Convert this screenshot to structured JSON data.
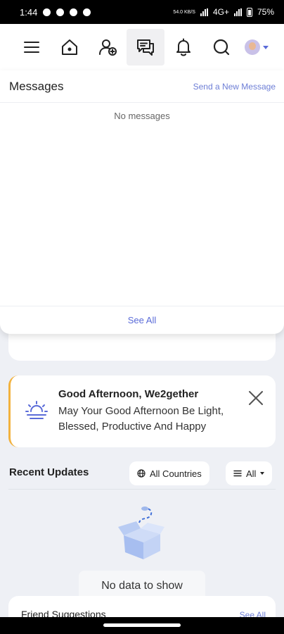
{
  "status_bar": {
    "time": "1:44",
    "network_speed": "54.0 KB/S",
    "network_type": "4G+",
    "battery": "75%"
  },
  "navbar": {
    "items": [
      {
        "icon": "menu-icon"
      },
      {
        "icon": "home-icon"
      },
      {
        "icon": "add-friend-icon"
      },
      {
        "icon": "messages-icon",
        "active": true
      },
      {
        "icon": "bell-icon"
      },
      {
        "icon": "search-icon"
      }
    ],
    "avatar_icon": "avatar",
    "accent_color": "#5a6bd8"
  },
  "messages_panel": {
    "title": "Messages",
    "send_link": "Send a New Message",
    "empty_text": "No messages",
    "see_all": "See All"
  },
  "greeting": {
    "title": "Good Afternoon, We2gether",
    "message": "May Your Good Afternoon Be Light, Blessed, Productive And Happy",
    "accent_color": "#f2b23e",
    "icon": "sunrise-icon"
  },
  "recent_updates": {
    "title": "Recent Updates",
    "country_filter": "All Countries",
    "type_filter": "All",
    "empty_text": "No data to show"
  },
  "friend_suggestions": {
    "title": "Friend Suggestions",
    "see_all": "See All"
  }
}
